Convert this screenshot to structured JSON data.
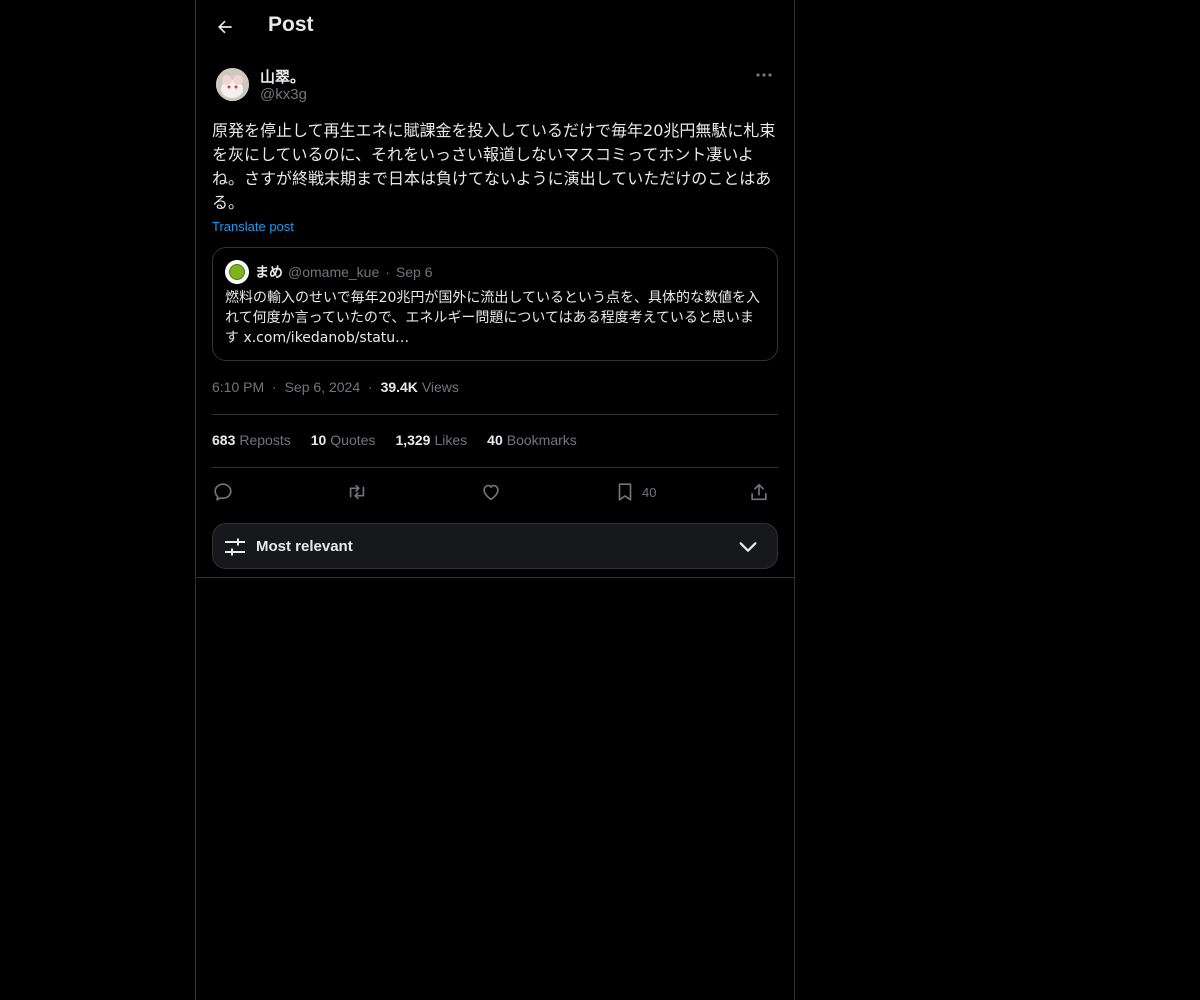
{
  "header": {
    "title": "Post",
    "back_icon": "arrow-left-icon"
  },
  "post": {
    "author": {
      "display_name": "山翠。",
      "handle": "@kx3g"
    },
    "more_icon": "ellipsis-icon",
    "text": "原発を停止して再生エネに賦課金を投入しているだけで毎年20兆円無駄に札束を灰にしているのに、それをいっさい報道しないマスコミってホント凄いよね。さすが終戦末期まで日本は負けてないように演出していただけのことはある。",
    "translate_label": "Translate post",
    "quote": {
      "name": "まめ",
      "handle": "@omame_kue",
      "separator": "·",
      "date": "Sep 6",
      "text": "燃料の輸入のせいで毎年20兆円が国外に流出しているという点を、具体的な数値を入れて何度か言っていたので、エネルギー問題についてはある程度考えていると思います x.com/ikedanob/statu…"
    },
    "time": "6:10 PM",
    "dot": "·",
    "date": "Sep 6, 2024",
    "views_count": "39.4K",
    "views_label": "Views"
  },
  "stats": {
    "reposts": {
      "count": "683",
      "label": "Reposts"
    },
    "quotes": {
      "count": "10",
      "label": "Quotes"
    },
    "likes": {
      "count": "1,329",
      "label": "Likes"
    },
    "bookmarks": {
      "count": "40",
      "label": "Bookmarks"
    }
  },
  "actions": {
    "reply_icon": "reply-icon",
    "repost_icon": "repost-icon",
    "like_icon": "heart-icon",
    "bookmark_icon": "bookmark-icon",
    "bookmark_count": "40",
    "share_icon": "share-icon"
  },
  "sort": {
    "label": "Most relevant",
    "icon": "sliders-icon",
    "chevron": "chevron-down-icon"
  },
  "colors": {
    "background": "#000000",
    "text": "#e7e9ea",
    "muted": "#71767b",
    "accent": "#1d9bf0",
    "border": "#2f3336"
  }
}
